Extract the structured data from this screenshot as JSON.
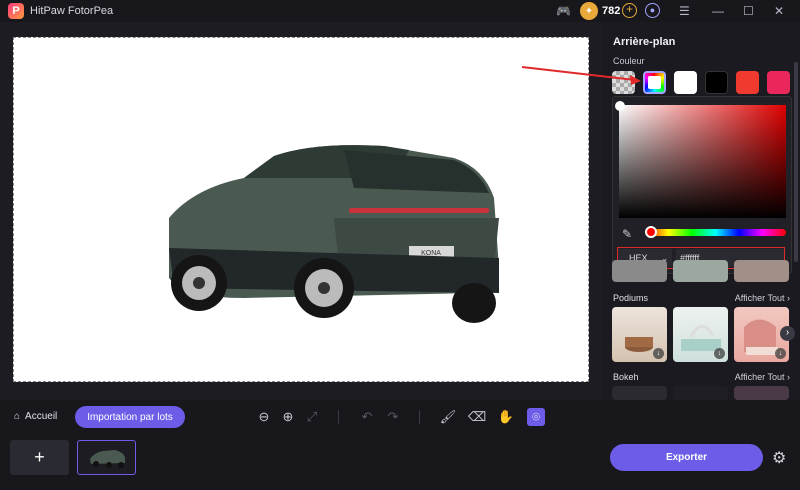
{
  "app": {
    "title": "HitPaw FotorPea",
    "coins": "782"
  },
  "panel": {
    "title": "Arrière-plan",
    "color_label": "Couleur",
    "hex_mode": "HEX",
    "hex_value": "#ffffff",
    "sections": [
      {
        "title": "Podiums",
        "link": "Afficher Tout ›"
      },
      {
        "title": "Bokeh",
        "link": "Afficher Tout ›"
      }
    ],
    "swatch_colors": [
      "#ffffff",
      "#000000",
      "#f03a30",
      "#e9275a"
    ]
  },
  "bottom": {
    "home_label": "Accueil",
    "batch_label": "Importation par lots",
    "export_label": "Exporter"
  },
  "car": {
    "plate": "KONA"
  }
}
